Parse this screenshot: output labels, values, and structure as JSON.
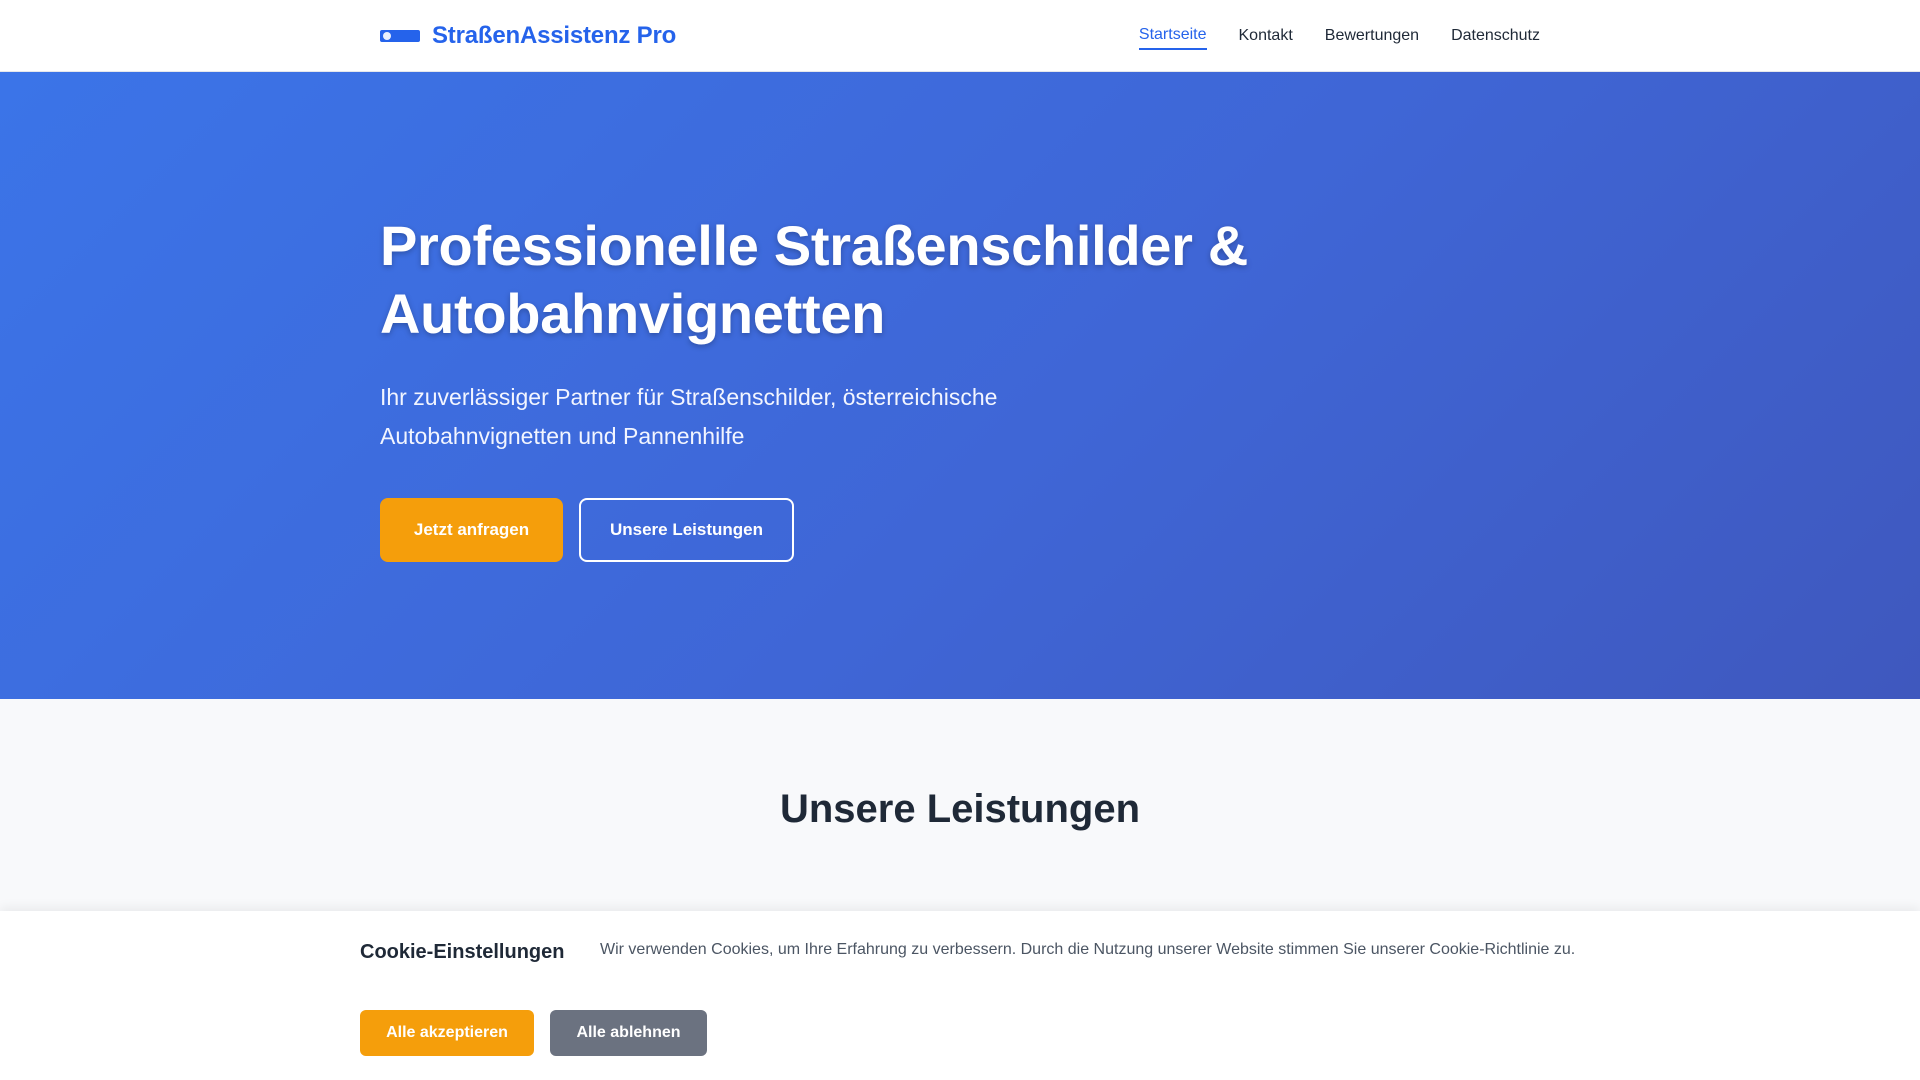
{
  "header": {
    "brand_name": "StraßenAssistenz Pro",
    "logo_icon": "sign-logo-icon",
    "nav": [
      {
        "label": "Startseite",
        "active": true
      },
      {
        "label": "Kontakt",
        "active": false
      },
      {
        "label": "Bewertungen",
        "active": false
      },
      {
        "label": "Datenschutz",
        "active": false
      }
    ]
  },
  "hero": {
    "title_line1": "Professionelle Straßenschilder &",
    "title_line2": "Autobahnvignetten",
    "subtitle": "Ihr zuverlässiger Partner für Straßenschilder, österreichische Autobahnvignetten und Pannenhilfe",
    "primary_button": "Jetzt anfragen",
    "secondary_button": "Unsere Leistungen"
  },
  "services": {
    "title": "Unsere Leistungen"
  },
  "cookie": {
    "title": "Cookie-Einstellungen",
    "text": "Wir verwenden Cookies, um Ihre Erfahrung zu verbessern. Durch die Nutzung unserer Website stimmen Sie unserer Cookie-Richtlinie zu.",
    "accept_button": "Alle akzeptieren",
    "reject_button": "Alle ablehnen"
  },
  "colors": {
    "brand": "#2563eb",
    "accent": "#f59e0b",
    "reject": "#6b7280",
    "hero_start": "#3b74e8",
    "hero_end": "#3f58be"
  }
}
